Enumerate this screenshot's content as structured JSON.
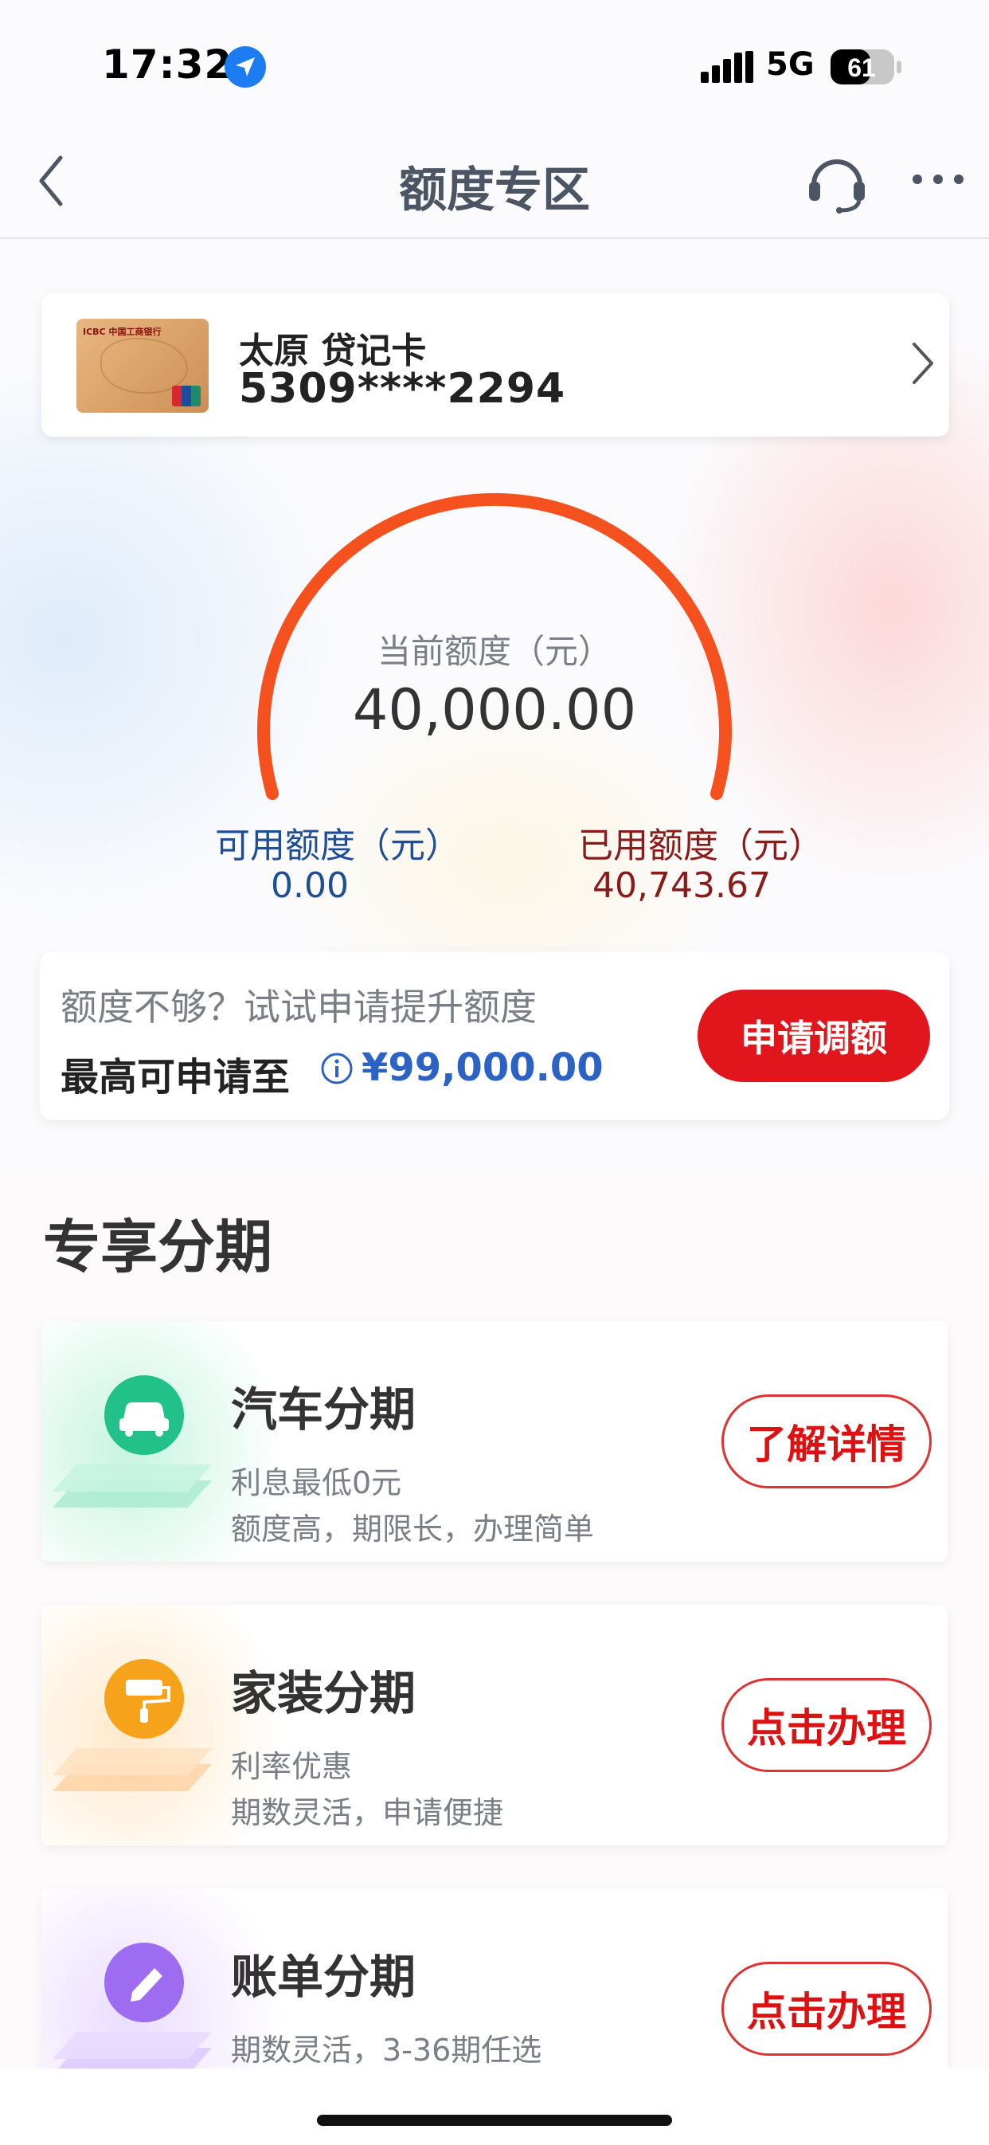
{
  "status_bar": {
    "time": "17:32",
    "network": "5G",
    "battery": "61"
  },
  "nav": {
    "title": "额度专区"
  },
  "card": {
    "name": "太原 贷记卡",
    "number": "5309****2294",
    "bank_logo": "ICBC 中国工商银行"
  },
  "gauge": {
    "label": "当前额度（元）",
    "value": "40,000.00",
    "used_fraction": 1.0
  },
  "available": {
    "label": "可用额度（元）",
    "value": "0.00"
  },
  "used": {
    "label": "已用额度（元）",
    "value": "40,743.67"
  },
  "raise": {
    "hint": "额度不够？试试申请提升额度",
    "max_label": "最高可申请至",
    "max_amount": "¥99,000.00",
    "button": "申请调额"
  },
  "section": {
    "title": "专享分期"
  },
  "installments": [
    {
      "title": "汽车分期",
      "line1": "利息最低0元",
      "line2": "额度高，期限长，办理简单",
      "button": "了解详情",
      "icon": "car-icon",
      "color": "#22c18a"
    },
    {
      "title": "家装分期",
      "line1": "利率优惠",
      "line2": "期数灵活，申请便捷",
      "button": "点击办理",
      "icon": "paint-roller-icon",
      "color": "#f7a21b"
    },
    {
      "title": "账单分期",
      "line1": "期数灵活，3-36期任选",
      "line2": "",
      "button": "点击办理",
      "icon": "pencil-icon",
      "color": "#9d6cf0"
    }
  ],
  "colors": {
    "accent_red": "#e1161c",
    "gauge_orange": "#f4511e",
    "blue": "#2b62c4"
  }
}
